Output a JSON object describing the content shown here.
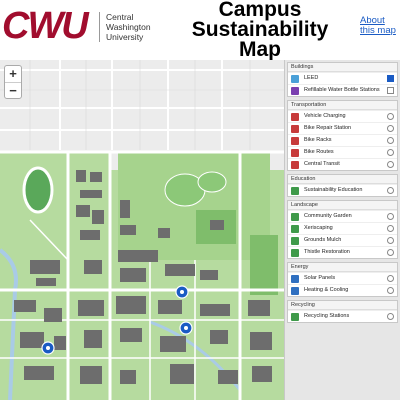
{
  "header": {
    "logo": "CWU",
    "institution": [
      "Central",
      "Washington",
      "University"
    ],
    "title_line1": "Campus",
    "title_line2": "Sustainability",
    "title_line3": "Map",
    "about_line1": "About",
    "about_line2": "this map"
  },
  "map": {
    "zoom_in": "+",
    "zoom_out": "−",
    "colors": {
      "green": "#9fd08a",
      "dark_green": "#3f8f3f",
      "building": "#6d6d6d",
      "road": "#ffffff",
      "water": "#a9cbe6",
      "marker": "#1a5bc4"
    }
  },
  "sidebar": {
    "groups": [
      {
        "title": "Buildings",
        "items": [
          {
            "label": "LEED",
            "icon": "leed-icon",
            "color": "#4aa0d8",
            "control": "checkbox",
            "checked": true
          },
          {
            "label": "Refillable Water Bottle Stations",
            "icon": "water-bottle-icon",
            "color": "#7a3fb0",
            "control": "checkbox",
            "checked": false
          }
        ]
      },
      {
        "title": "Transportation",
        "items": [
          {
            "label": "Vehicle Charging",
            "icon": "ev-charger-icon",
            "color": "#c73a3a",
            "control": "radio",
            "checked": false
          },
          {
            "label": "Bike Repair Station",
            "icon": "bike-repair-icon",
            "color": "#c73a3a",
            "control": "radio",
            "checked": false
          },
          {
            "label": "Bike Racks",
            "icon": "bike-rack-icon",
            "color": "#c73a3a",
            "control": "radio",
            "checked": false
          },
          {
            "label": "Bike Routes",
            "icon": "bike-route-icon",
            "color": "#c73a3a",
            "control": "radio",
            "checked": false
          },
          {
            "label": "Central Transit",
            "icon": "bus-icon",
            "color": "#c73a3a",
            "control": "radio",
            "checked": false
          }
        ]
      },
      {
        "title": "Education",
        "items": [
          {
            "label": "Sustainability Education",
            "icon": "education-icon",
            "color": "#3f9a4a",
            "control": "radio",
            "checked": false
          }
        ]
      },
      {
        "title": "Landscape",
        "items": [
          {
            "label": "Community Garden",
            "icon": "garden-icon",
            "color": "#3f9a4a",
            "control": "radio",
            "checked": false
          },
          {
            "label": "Xeriscaping",
            "icon": "xeriscape-icon",
            "color": "#3f9a4a",
            "control": "radio",
            "checked": false
          },
          {
            "label": "Grounds Mulch",
            "icon": "mulch-icon",
            "color": "#3f9a4a",
            "control": "radio",
            "checked": false
          },
          {
            "label": "Thistle Restoration",
            "icon": "restoration-icon",
            "color": "#3f9a4a",
            "control": "radio",
            "checked": false
          }
        ]
      },
      {
        "title": "Energy",
        "items": [
          {
            "label": "Solar Panels",
            "icon": "solar-panel-icon",
            "color": "#2f6fc0",
            "control": "radio",
            "checked": false
          },
          {
            "label": "Heating & Cooling",
            "icon": "heating-icon",
            "color": "#2f6fc0",
            "control": "radio",
            "checked": false
          }
        ]
      },
      {
        "title": "Recycling",
        "items": [
          {
            "label": "Recycling Stations",
            "icon": "recycling-icon",
            "color": "#3f9a4a",
            "control": "radio",
            "checked": false
          }
        ]
      }
    ]
  }
}
